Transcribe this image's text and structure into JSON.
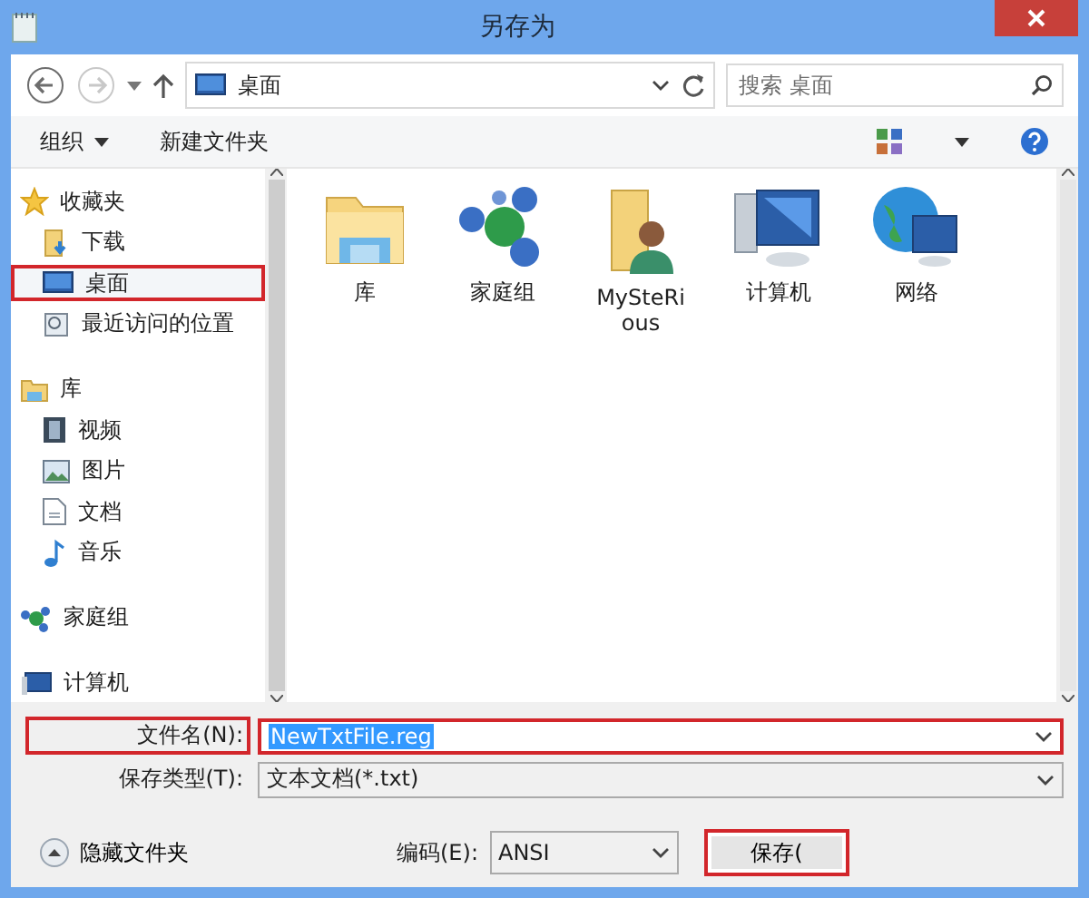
{
  "window": {
    "title": "另存为"
  },
  "navigation": {
    "path": "桌面",
    "search_placeholder": "搜索 桌面"
  },
  "command_bar": {
    "organize": "组织",
    "new_folder": "新建文件夹"
  },
  "sidebar": {
    "groups": [
      {
        "label": "收藏夹",
        "selected": false,
        "highlighted": false,
        "children": [
          {
            "label": "下载",
            "selected": false,
            "highlighted": false
          },
          {
            "label": "桌面",
            "selected": true,
            "highlighted": true
          },
          {
            "label": "最近访问的位置",
            "selected": false,
            "highlighted": false
          }
        ]
      },
      {
        "label": "库",
        "selected": false,
        "highlighted": false,
        "children": [
          {
            "label": "视频",
            "selected": false,
            "highlighted": false
          },
          {
            "label": "图片",
            "selected": false,
            "highlighted": false
          },
          {
            "label": "文档",
            "selected": false,
            "highlighted": false
          },
          {
            "label": "音乐",
            "selected": false,
            "highlighted": false
          }
        ]
      },
      {
        "label": "家庭组",
        "selected": false,
        "highlighted": false
      },
      {
        "label": "计算机",
        "selected": false,
        "highlighted": false
      }
    ]
  },
  "files": [
    {
      "name": "库"
    },
    {
      "name": "家庭组"
    },
    {
      "name": "MySteRious"
    },
    {
      "name": "计算机"
    },
    {
      "name": "网络"
    }
  ],
  "footer": {
    "filename_label": "文件名(N):",
    "filename": "NewTxtFile.reg",
    "filename_highlighted": true,
    "type_label": "保存类型(T):",
    "type": "文本文档(*.txt)",
    "hide_folders": "隐藏文件夹",
    "encoding_label": "编码(E):",
    "encoding": "ANSI",
    "save": "保存(",
    "save_highlighted": true
  }
}
